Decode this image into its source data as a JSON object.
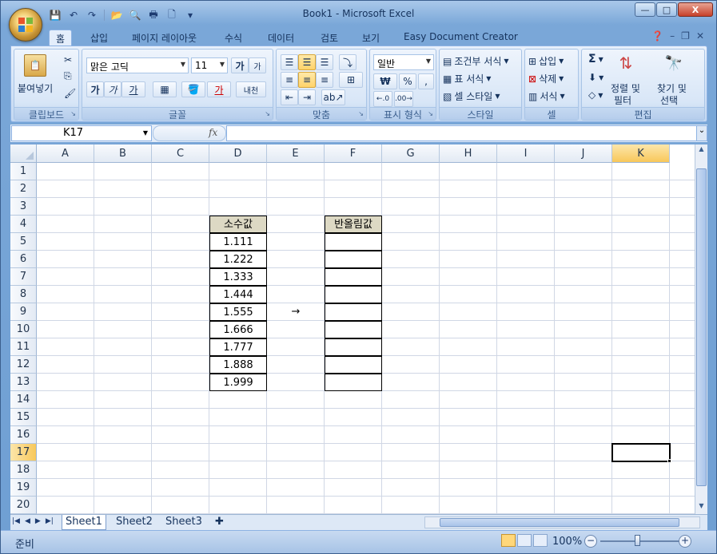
{
  "window": {
    "title": "Book1 - Microsoft Excel",
    "minimize_label": "—",
    "maximize_label": "□",
    "close_label": "X"
  },
  "quick_access": {
    "save_icon": "save-icon",
    "undo_icon": "undo-icon",
    "redo_icon": "redo-icon"
  },
  "ribbon_tabs": [
    "홈",
    "삽입",
    "페이지 레이아웃",
    "수식",
    "데이터",
    "검토",
    "보기",
    "Easy Document Creator"
  ],
  "ribbon": {
    "clipboard": {
      "label": "클립보드",
      "paste_label": "붙여넣기"
    },
    "font": {
      "label": "글꼴",
      "font_name": "맑은 고딕",
      "font_size": "11",
      "bold": "가",
      "italic": "가",
      "underline": "가",
      "grow": "가",
      "font_color": "가",
      "phonetic": "내천"
    },
    "alignment": {
      "label": "맞춤"
    },
    "number": {
      "label": "표시 형식",
      "format": "일반",
      "currency": "₩",
      "percent": "%",
      "comma": ","
    },
    "styles": {
      "label": "스타일",
      "conditional": "조건부 서식",
      "table": "표 서식",
      "cell_style": "셀 스타일"
    },
    "cells": {
      "label": "셀",
      "insert": "삽입",
      "delete": "삭제",
      "format": "서식"
    },
    "editing": {
      "label": "편집",
      "sort_filter": "정렬 및",
      "sort_filter2": "필터",
      "find_select": "찾기 및",
      "find_select2": "선택",
      "sum": "Σ"
    }
  },
  "formula_bar": {
    "name_box": "K17",
    "fx": "fx",
    "formula": ""
  },
  "columns": [
    "A",
    "B",
    "C",
    "D",
    "E",
    "F",
    "G",
    "H",
    "I",
    "J",
    "K"
  ],
  "selected_column": "K",
  "rows": [
    "1",
    "2",
    "3",
    "4",
    "5",
    "6",
    "7",
    "8",
    "9",
    "10",
    "11",
    "12",
    "13",
    "14",
    "15",
    "16",
    "17",
    "18",
    "19",
    "20"
  ],
  "selected_row": "17",
  "cells": {
    "D4": "소수값",
    "D5": "1.111",
    "D6": "1.222",
    "D7": "1.333",
    "D8": "1.444",
    "D9": "1.555",
    "D10": "1.666",
    "D11": "1.777",
    "D12": "1.888",
    "D13": "1.999",
    "E9": "→",
    "F4": "반올림값"
  },
  "sheet_tabs": [
    "Sheet1",
    "Sheet2",
    "Sheet3"
  ],
  "active_sheet": "Sheet1",
  "status": {
    "ready": "준비",
    "zoom": "100%"
  }
}
